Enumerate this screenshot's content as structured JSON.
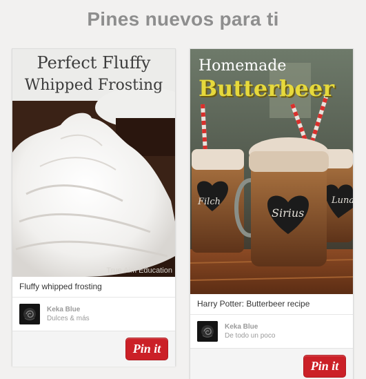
{
  "heading": "Pines nuevos para ti",
  "pins": [
    {
      "image_title_line1": "Perfect Fluffy",
      "image_title_line2": "Whipped Frosting",
      "watermark": "True Aim Education",
      "description": "Fluffy whipped frosting",
      "pinner_name": "Keka Blue",
      "board_name": "Dulces & más",
      "button_label": "Pin it"
    },
    {
      "image_title_line1": "Homemade",
      "image_title_line2": "Butterbeer",
      "mug_labels": [
        "Filch",
        "Sirius",
        "Luna"
      ],
      "description": "Harry Potter: Butterbeer recipe",
      "pinner_name": "Keka Blue",
      "board_name": "De todo un poco",
      "button_label": "Pin it"
    }
  ],
  "colors": {
    "accent": "#cb2027",
    "heading": "#8e8e8e",
    "background": "#f2f1f0"
  }
}
